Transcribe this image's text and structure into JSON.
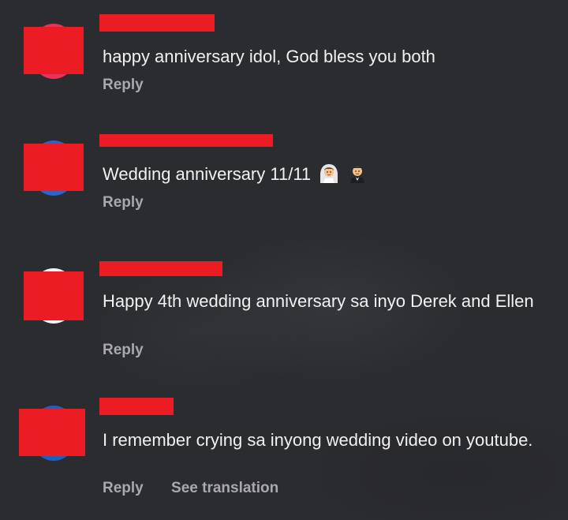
{
  "colors": {
    "background": "#2b2c30",
    "redaction": "#ec1c24",
    "comment_text": "#f1f1f1",
    "action_text": "#a9a9ad"
  },
  "comments": [
    {
      "username": "",
      "text": "happy anniversary idol, God bless you both",
      "reply_label": "Reply",
      "avatar_color": "#e8325a"
    },
    {
      "username": "",
      "text": "Wedding anniversary 11/11",
      "emojis": [
        "bride-with-veil-icon",
        "groom-in-tuxedo-icon"
      ],
      "reply_label": "Reply",
      "avatar_color": "#2a66c9"
    },
    {
      "username": "",
      "text": "Happy 4th wedding anniversary sa inyo Derek and Ellen",
      "reply_label": "Reply",
      "avatar_color": "#f4f4f4"
    },
    {
      "username": "",
      "text": "I remember crying sa inyong wedding video on youtube.",
      "reply_label": "Reply",
      "translate_label": "See translation",
      "avatar_color": "#1f5fbf"
    }
  ]
}
